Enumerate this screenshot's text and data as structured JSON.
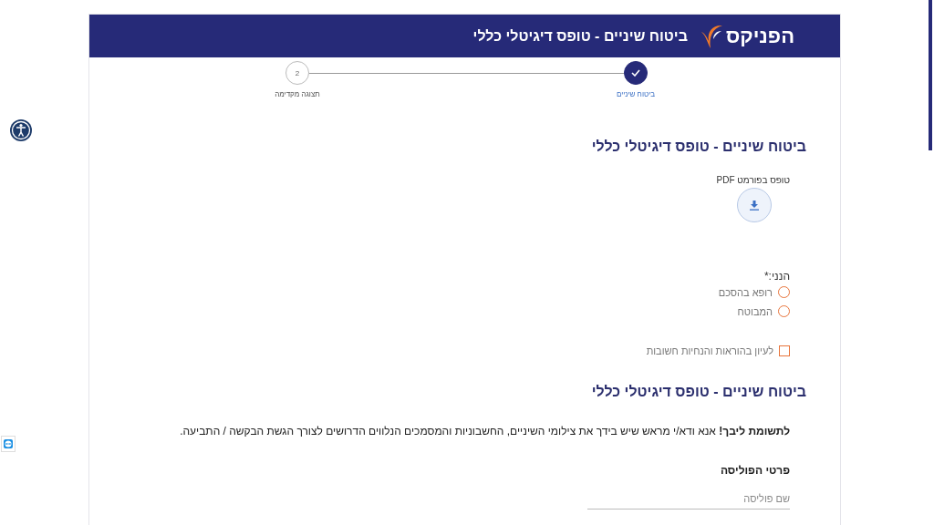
{
  "header": {
    "logo": "הפניקס",
    "title": "ביטוח שיניים - טופס דיגיטלי כללי"
  },
  "steps": [
    {
      "label": "ביטוח שיניים",
      "completed": true
    },
    {
      "label": "תצוגה מקדימה",
      "number": "2",
      "completed": false
    }
  ],
  "form": {
    "section_title": "ביטוח שיניים - טופס דיגיטלי כללי",
    "pdf_label": "טופס בפורמט PDF",
    "identity_label": "הנני:*",
    "identity_options": [
      {
        "label": "רופא בהסכם",
        "selected": false
      },
      {
        "label": "המבוטח",
        "selected": false
      }
    ],
    "instructions_checkbox": {
      "label": "לעיון בהוראות והנחיות חשובות",
      "checked": false
    }
  },
  "details": {
    "section_title": "ביטוח שיניים - טופס דיגיטלי כללי",
    "notice": "**לתשומת ליבך!** אנא ודא/י מראש שיש בידך את צילומי השיניים, החשבוניות והמסמכים הנלווים הדרושים לצורך הגשת הבקשה / התביעה.",
    "subheading": "פרטי הפוליסה",
    "policy_field": {
      "placeholder": "שם פוליסה"
    }
  }
}
